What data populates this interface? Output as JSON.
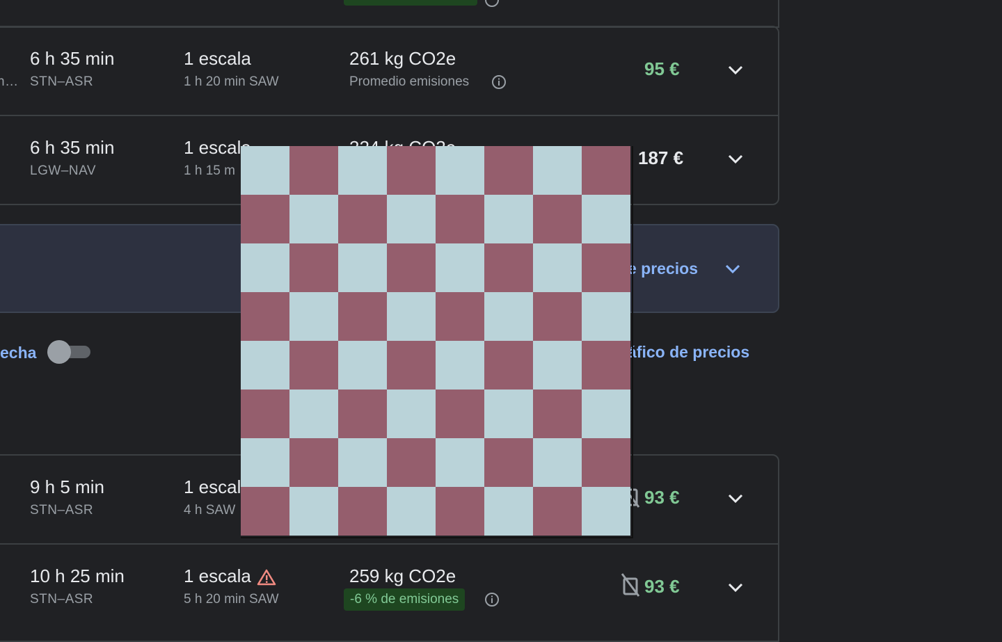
{
  "top_fragment": {
    "badge_text": ""
  },
  "flights": [
    {
      "duration": "6 h 35 min",
      "route": "STN–ASR",
      "stops": "1 escala",
      "stop_detail": "1 h 20 min SAW",
      "co2": "261 kg CO2e",
      "co2_note": "Promedio emisiones",
      "price": "95 €",
      "left_fragment": "n…"
    },
    {
      "duration": "6 h 35 min",
      "route": "LGW–NAV",
      "stops": "1 escala",
      "stop_detail": "1 h 15 m",
      "co2": "324 kg CO2e",
      "price": "187 €"
    },
    {
      "duration": "9 h 5 min",
      "route": "STN–ASR",
      "stops": "1 escala",
      "stop_detail": "4 h SAW",
      "price": "93 €"
    },
    {
      "duration": "10 h 25 min",
      "route": "STN–ASR",
      "stops": "1 escala",
      "stop_detail": "5 h 20 min SAW",
      "co2": "259 kg CO2e",
      "co2_badge": "-6 % de emisiones",
      "price": "93 €"
    }
  ],
  "price_banner": {
    "link_text": "e precios"
  },
  "controls": {
    "toggle_label": "echa",
    "chart_link": "áfico de precios"
  },
  "icons": {
    "expand": "chevron-down-icon",
    "info": "info-icon",
    "warning": "warning-icon",
    "no_bag": "no-carry-on-icon"
  },
  "colors": {
    "background": "#202124",
    "price_green": "#81c995",
    "link_blue": "#8ab4f8",
    "warning": "#f28b82"
  }
}
